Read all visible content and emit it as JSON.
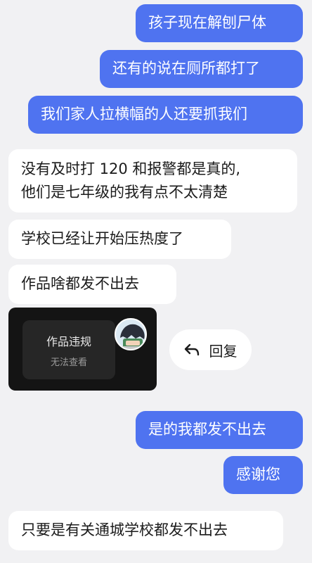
{
  "messages": {
    "m1": "孩子现在解刨尸体",
    "m2": "还有的说在厕所都打了",
    "m3": "我们家人拉横幅的人还要抓我们",
    "m4_line1": "没有及时打 120 和报警都是真的,",
    "m4_line2": "他们是七年级的我有点不太清楚",
    "m5": "学校已经让开始压热度了",
    "m6": "作品啥都发不出去",
    "m7": "是的我都发不出去",
    "m8": "感谢您",
    "m9": "只要是有关通城学校都发不出去"
  },
  "shared_post": {
    "title": "作品违规",
    "subtitle": "无法查看"
  },
  "reply_button": {
    "label": "回复",
    "icon": "reply-arrow-icon"
  },
  "colors": {
    "outgoing_bubble": "#4f73f0",
    "incoming_bubble": "#ffffff",
    "background": "#f1f1f3"
  }
}
